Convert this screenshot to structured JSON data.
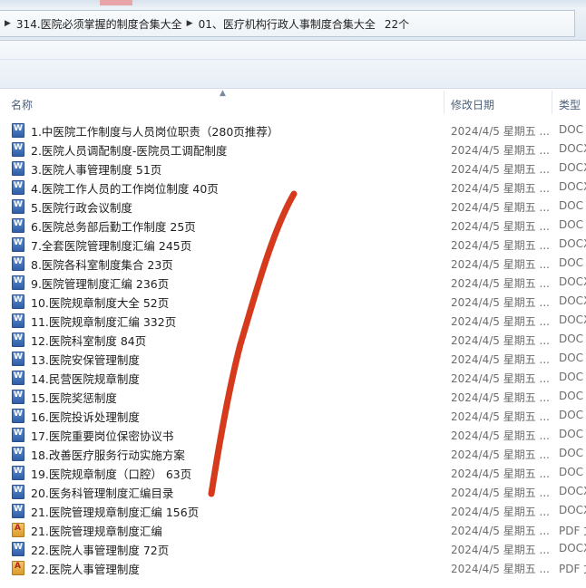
{
  "address_bar": {
    "crumbs": [
      "314.医院必须掌握的制度合集大全",
      "01、医疗机构行政人事制度合集大全"
    ],
    "item_count": "22个"
  },
  "columns": {
    "name": "名称",
    "modified": "修改日期",
    "type": "类型"
  },
  "files": [
    {
      "name": "1.中医院工作制度与人员岗位职责（280页推荐）",
      "date": "2024/4/5  星期五 ...",
      "type": "DOC",
      "icon": "word-doc-icon"
    },
    {
      "name": "2.医院人员调配制度-医院员工调配制度",
      "date": "2024/4/5  星期五 ...",
      "type": "DOCX",
      "icon": "word-doc-icon"
    },
    {
      "name": "3.医院人事管理制度 51页",
      "date": "2024/4/5  星期五 ...",
      "type": "DOCX",
      "icon": "word-doc-icon"
    },
    {
      "name": "4.医院工作人员的工作岗位制度  40页",
      "date": "2024/4/5  星期五 ...",
      "type": "DOCX",
      "icon": "word-doc-icon"
    },
    {
      "name": "5.医院行政会议制度",
      "date": "2024/4/5  星期五 ...",
      "type": "DOC",
      "icon": "word-doc-icon"
    },
    {
      "name": "6.医院总务部后勤工作制度 25页",
      "date": "2024/4/5  星期五 ...",
      "type": "DOC",
      "icon": "word-doc-icon"
    },
    {
      "name": "7.全套医院管理制度汇编 245页",
      "date": "2024/4/5  星期五 ...",
      "type": "DOCX",
      "icon": "word-doc-icon"
    },
    {
      "name": "8.医院各科室制度集合  23页",
      "date": "2024/4/5  星期五 ...",
      "type": "DOC",
      "icon": "word-doc-icon"
    },
    {
      "name": "9.医院管理制度汇编 236页",
      "date": "2024/4/5  星期五 ...",
      "type": "DOCX",
      "icon": "word-doc-icon"
    },
    {
      "name": "10.医院规章制度大全 52页",
      "date": "2024/4/5  星期五 ...",
      "type": "DOCX",
      "icon": "word-doc-icon"
    },
    {
      "name": "11.医院规章制度汇编  332页",
      "date": "2024/4/5  星期五 ...",
      "type": "DOCX",
      "icon": "word-doc-icon"
    },
    {
      "name": "12.医院科室制度  84页",
      "date": "2024/4/5  星期五 ...",
      "type": "DOC",
      "icon": "word-doc-icon"
    },
    {
      "name": "13.医院安保管理制度",
      "date": "2024/4/5  星期五 ...",
      "type": "DOC",
      "icon": "word-doc-icon"
    },
    {
      "name": "14.民营医院规章制度",
      "date": "2024/4/5  星期五 ...",
      "type": "DOC",
      "icon": "word-doc-icon"
    },
    {
      "name": "15.医院奖惩制度",
      "date": "2024/4/5  星期五 ...",
      "type": "DOC",
      "icon": "word-doc-icon"
    },
    {
      "name": "16.医院投诉处理制度",
      "date": "2024/4/5  星期五 ...",
      "type": "DOC",
      "icon": "word-doc-icon"
    },
    {
      "name": "17.医院重要岗位保密协议书",
      "date": "2024/4/5  星期五 ...",
      "type": "DOC",
      "icon": "word-doc-icon"
    },
    {
      "name": "18.改善医疗服务行动实施方案",
      "date": "2024/4/5  星期五 ...",
      "type": "DOC",
      "icon": "word-doc-icon"
    },
    {
      "name": "19.医院规章制度（口腔）  63页",
      "date": "2024/4/5  星期五 ...",
      "type": "DOC",
      "icon": "word-doc-icon"
    },
    {
      "name": "20.医务科管理制度汇编目录",
      "date": "2024/4/5  星期五 ...",
      "type": "DOCX",
      "icon": "word-doc-icon"
    },
    {
      "name": "21.医院管理规章制度汇编 156页",
      "date": "2024/4/5  星期五 ...",
      "type": "DOCX",
      "icon": "word-doc-icon"
    },
    {
      "name": "21.医院管理规章制度汇编",
      "date": "2024/4/5  星期五 ...",
      "type": "PDF 文",
      "icon": "pdf-icon"
    },
    {
      "name": "22.医院人事管理制度  72页",
      "date": "2024/4/5  星期五 ...",
      "type": "DOCX",
      "icon": "word-doc-icon"
    },
    {
      "name": "22.医院人事管理制度",
      "date": "2024/4/5  星期五 ...",
      "type": "PDF 文",
      "icon": "pdf-icon"
    }
  ],
  "colors": {
    "annotation_stroke": "#d63a1c",
    "header_text": "#4c607a",
    "muted_text": "#6d6d6d"
  }
}
